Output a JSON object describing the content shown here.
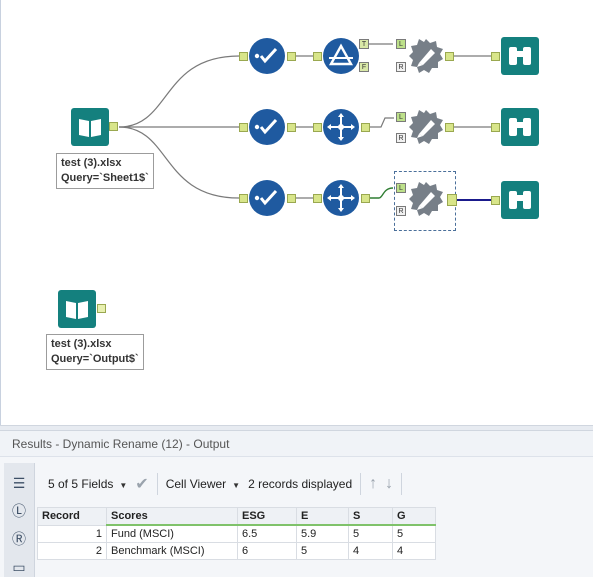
{
  "workflow": {
    "input1": {
      "label_line1": "test (3).xlsx",
      "label_line2": "Query=`Sheet1$`"
    },
    "input2": {
      "label_line1": "test (3).xlsx",
      "label_line2": "Query=`Output$`"
    },
    "anchors": {
      "true": "T",
      "false": "F",
      "left": "L",
      "right": "R"
    },
    "tool_icons": {
      "input": "book-icon",
      "select": "checkmark-circle-icon",
      "filter": "triangle-filter-icon",
      "dynamic_rename": "gear-pencil-icon",
      "browse": "binoculars-icon",
      "record_id": "crosshair-icon"
    },
    "colors": {
      "teal": "#14807e",
      "blue": "#1f5aa0",
      "grey": "#6f7a85",
      "connector": "#7a7a7a",
      "selected_connector": "#1a1a8c"
    }
  },
  "results": {
    "title": "Results - Dynamic Rename (12) - Output",
    "toolbar": {
      "fields_label": "5 of 5 Fields",
      "cell_viewer_label": "Cell Viewer",
      "records_label": "2 records displayed"
    },
    "columns": [
      "Record",
      "Scores",
      "ESG",
      "E",
      "S",
      "G"
    ],
    "rows": [
      [
        "1",
        "Fund (MSCI)",
        "6.5",
        "5.9",
        "5",
        "5"
      ],
      [
        "2",
        "Benchmark (MSCI)",
        "6",
        "5",
        "4",
        "4"
      ]
    ]
  }
}
